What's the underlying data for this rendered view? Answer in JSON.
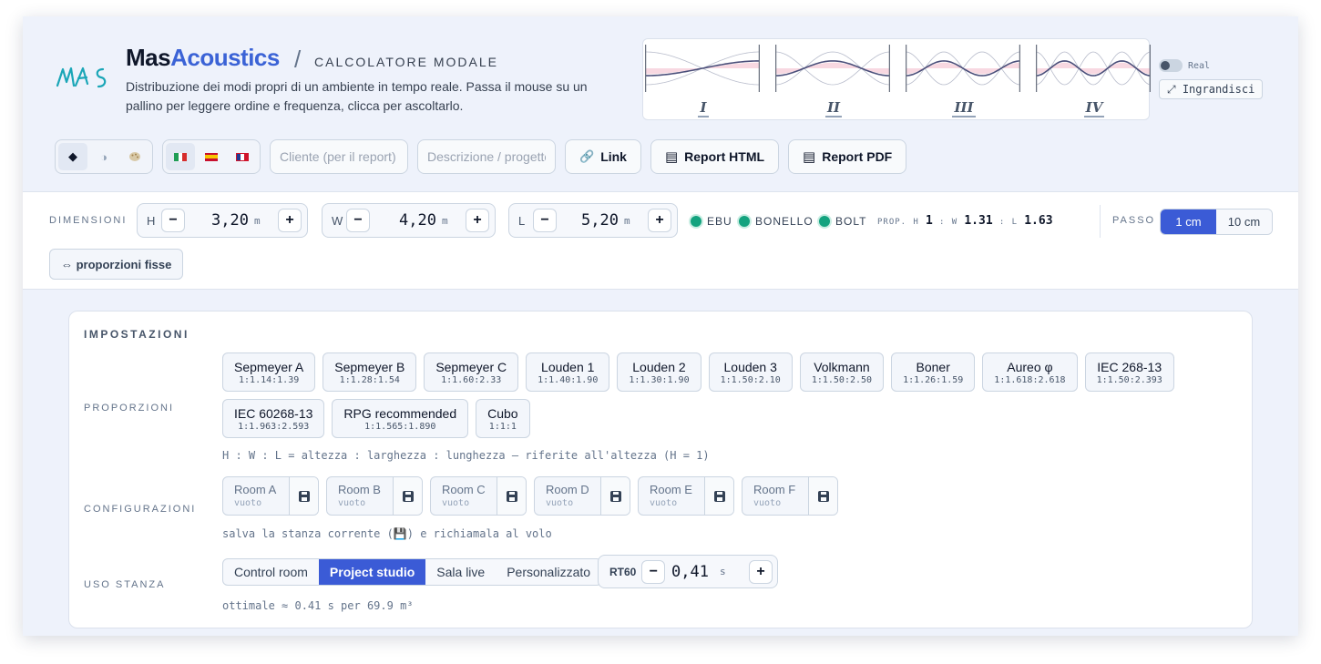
{
  "brand": {
    "part1": "Mas",
    "part2": "Acoustics",
    "separator": "/",
    "subtitle": "CALCOLATORE MODALE",
    "logo_text": "MAS"
  },
  "description": "Distribuzione dei modi propri di un ambiente in tempo reale. Passa il mouse su un pallino per leggere ordine e frequenza, clicca per ascoltarlo.",
  "modes": [
    {
      "label": "I",
      "order": 1
    },
    {
      "label": "II",
      "order": 2
    },
    {
      "label": "III",
      "order": 3
    },
    {
      "label": "IV",
      "order": 4
    }
  ],
  "real_toggle": {
    "label": "Real",
    "on": false
  },
  "enlarge_label": "⤢ Ingrandisci",
  "toolbar": {
    "theme_icons": [
      "dark-mode-icon",
      "contrast-icon",
      "palette-icon"
    ],
    "language_flags": [
      {
        "name": "italian-flag-icon",
        "colors": [
          "#1f9d55",
          "#ffffff",
          "#d62d2d"
        ]
      },
      {
        "name": "spanish-flag-icon",
        "colors": [
          "#c8102e",
          "#f7c600",
          "#c8102e"
        ]
      },
      {
        "name": "english-flag-icon",
        "colors": [
          "#1f3a93",
          "#ffffff",
          "#cf142b"
        ]
      }
    ],
    "client_placeholder": "Cliente (per il report)",
    "description_placeholder": "Descrizione / progetto",
    "link_label": "Link",
    "report_html_label": "Report HTML",
    "report_pdf_label": "Report PDF"
  },
  "dimensions": {
    "label": "DIMENSIONI",
    "fields": [
      {
        "letter": "H",
        "value": "3,20",
        "unit": "m"
      },
      {
        "letter": "W",
        "value": "4,20",
        "unit": "m"
      },
      {
        "letter": "L",
        "value": "5,20",
        "unit": "m"
      }
    ],
    "minus": "−",
    "plus": "+",
    "standards": [
      "EBU",
      "BONELLO",
      "BOLT"
    ],
    "proportion": {
      "label": "PROP.",
      "h_key": "H",
      "h": "1",
      "w_key": "W",
      "w": "1.31",
      "l_key": "L",
      "l": "1.63",
      "sep": ":"
    },
    "step_label": "PASSO",
    "steps": [
      {
        "label": "1 cm",
        "active": true
      },
      {
        "label": "10 cm",
        "active": false
      }
    ],
    "fixed_label": "⇔ proporzioni fisse"
  },
  "settings": {
    "title": "IMPOSTAZIONI",
    "proportions_label": "PROPORZIONI",
    "presets": [
      {
        "name": "Sepmeyer A",
        "ratio": "1:1.14:1.39"
      },
      {
        "name": "Sepmeyer B",
        "ratio": "1:1.28:1.54"
      },
      {
        "name": "Sepmeyer C",
        "ratio": "1:1.60:2.33"
      },
      {
        "name": "Louden 1",
        "ratio": "1:1.40:1.90"
      },
      {
        "name": "Louden 2",
        "ratio": "1:1.30:1.90"
      },
      {
        "name": "Louden 3",
        "ratio": "1:1.50:2.10"
      },
      {
        "name": "Volkmann",
        "ratio": "1:1.50:2.50"
      },
      {
        "name": "Boner",
        "ratio": "1:1.26:1.59"
      },
      {
        "name": "Aureo φ",
        "ratio": "1:1.618:2.618"
      },
      {
        "name": "IEC 268-13",
        "ratio": "1:1.50:2.393"
      },
      {
        "name": "IEC 60268-13",
        "ratio": "1:1.963:2.593"
      },
      {
        "name": "RPG recommended",
        "ratio": "1:1.565:1.890"
      },
      {
        "name": "Cubo",
        "ratio": "1:1:1"
      }
    ],
    "proportions_hint": "H : W : L = altezza : larghezza : lunghezza — riferite all'altezza (H = 1)",
    "configurations_label": "CONFIGURAZIONI",
    "rooms": [
      {
        "name": "Room A",
        "state": "vuoto"
      },
      {
        "name": "Room B",
        "state": "vuoto"
      },
      {
        "name": "Room C",
        "state": "vuoto"
      },
      {
        "name": "Room D",
        "state": "vuoto"
      },
      {
        "name": "Room E",
        "state": "vuoto"
      },
      {
        "name": "Room F",
        "state": "vuoto"
      }
    ],
    "configurations_hint": "salva la stanza corrente (💾) e richiamala al volo",
    "usage_label": "USO STANZA",
    "usages": [
      {
        "label": "Control room",
        "active": false
      },
      {
        "label": "Project studio",
        "active": true
      },
      {
        "label": "Sala live",
        "active": false
      },
      {
        "label": "Personalizzato",
        "active": false
      }
    ],
    "rt60": {
      "label": "RT60",
      "value": "0,41",
      "unit": "s"
    },
    "usage_hint": "ottimale ≈ 0.41 s per 69.9 m³"
  },
  "colors": {
    "accent": "#3b5bd6",
    "brand_accent": "#3b63d6",
    "standard_ok": "#14a37f",
    "mode_line": "#4b4f7a",
    "mode_fill": "#f0a9bd"
  }
}
